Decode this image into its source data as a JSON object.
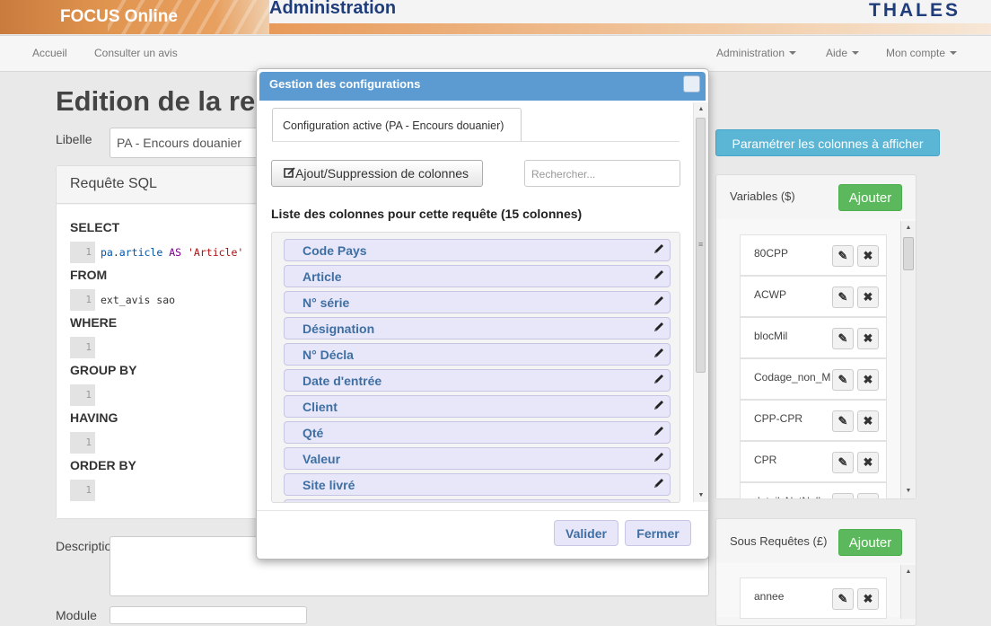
{
  "header": {
    "brand": "FOCUS Online",
    "section_title": "Administration",
    "logo_text": "THALES"
  },
  "nav": {
    "left": [
      "Accueil",
      "Consulter un avis"
    ],
    "right": [
      "Administration",
      "Aide",
      "Mon compte"
    ]
  },
  "page": {
    "title": "Edition de la re",
    "libelle_label": "Libelle",
    "libelle_value": "PA - Encours douanier",
    "sql_panel_title": "Requête SQL",
    "sql_sections": [
      {
        "keyword": "SELECT",
        "line": "1"
      },
      {
        "keyword": "FROM",
        "line": "1"
      },
      {
        "keyword": "WHERE",
        "line": "1"
      },
      {
        "keyword": "GROUP BY",
        "line": "1"
      },
      {
        "keyword": "HAVING",
        "line": "1"
      },
      {
        "keyword": "ORDER BY",
        "line": "1"
      }
    ],
    "select_code": {
      "table": "pa",
      "dot": ".",
      "field": "article",
      "as": "AS",
      "alias": "'Article'"
    },
    "from_code": "ext_avis sao",
    "description_label": "Descriptio",
    "module_label": "Module",
    "params_button": "Paramétrer les colonnes à afficher"
  },
  "variables": {
    "title": "Variables ($)",
    "add_label": "Ajouter",
    "items": [
      "80CPP",
      "ACWP",
      "blocMil",
      "Codage_non_M",
      "CPP-CPR",
      "CPR",
      "detailsNotNull"
    ]
  },
  "subqueries": {
    "title": "Sous Requêtes (£)",
    "add_label": "Ajouter",
    "items": [
      "annee"
    ]
  },
  "modal": {
    "title": "Gestion des configurations",
    "tab_label": "Configuration active (PA - Encours douanier)",
    "add_remove_label": "Ajout/Suppression de colonnes",
    "search_placeholder": "Rechercher...",
    "list_title": "Liste des colonnes pour cette requête (15 colonnes)",
    "columns": [
      "Code Pays",
      "Article",
      "N° série",
      "Désignation",
      "N° Décla",
      "Date d'entrée",
      "Client",
      "Qté",
      "Valeur",
      "Site livré"
    ],
    "validate_label": "Valider",
    "close_label": "Fermer"
  },
  "colors": {
    "modal_header": "#5c9bd1",
    "column_item_bg": "#e7e7f9",
    "column_item_text": "#3f6fa2",
    "add_button": "#5cb85c",
    "params_button": "#5bb5d4"
  },
  "icons": [
    "pencil-icon",
    "edit-icon",
    "delete-icon",
    "caret-down-icon",
    "external-edit-icon"
  ]
}
